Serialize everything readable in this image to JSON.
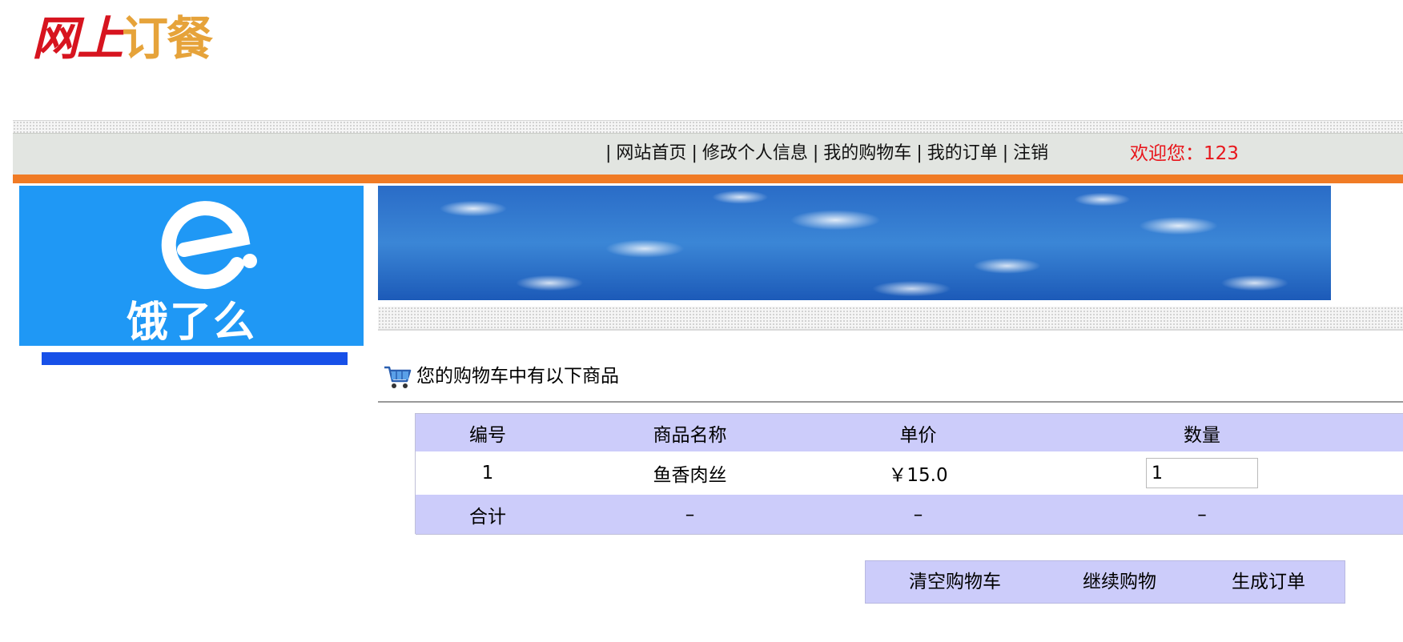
{
  "logo": {
    "part_red": "网上",
    "part_gold": "订餐"
  },
  "nav": {
    "items": [
      "网站首页",
      "修改个人信息",
      "我的购物车",
      "我的订单",
      "注销"
    ],
    "separator": "|",
    "welcome": "欢迎您：123"
  },
  "brand": {
    "name": "饿了么",
    "bg_color": "#1f98f5"
  },
  "cart": {
    "heading": "您的购物车中有以下商品",
    "columns": [
      "编号",
      "商品名称",
      "单价",
      "数量"
    ],
    "rows": [
      {
        "id": "1",
        "name": "鱼香肉丝",
        "price": "￥15.0",
        "quantity": "1"
      }
    ],
    "total": {
      "label": "合计",
      "name": "–",
      "price": "–",
      "quantity": "–"
    }
  },
  "actions": {
    "clear": "清空购物车",
    "continue": "继续购物",
    "order": "生成订单"
  },
  "colors": {
    "accent_orange": "#f07b25",
    "welcome_red": "#e8161c",
    "table_header": "#ccccfa"
  }
}
